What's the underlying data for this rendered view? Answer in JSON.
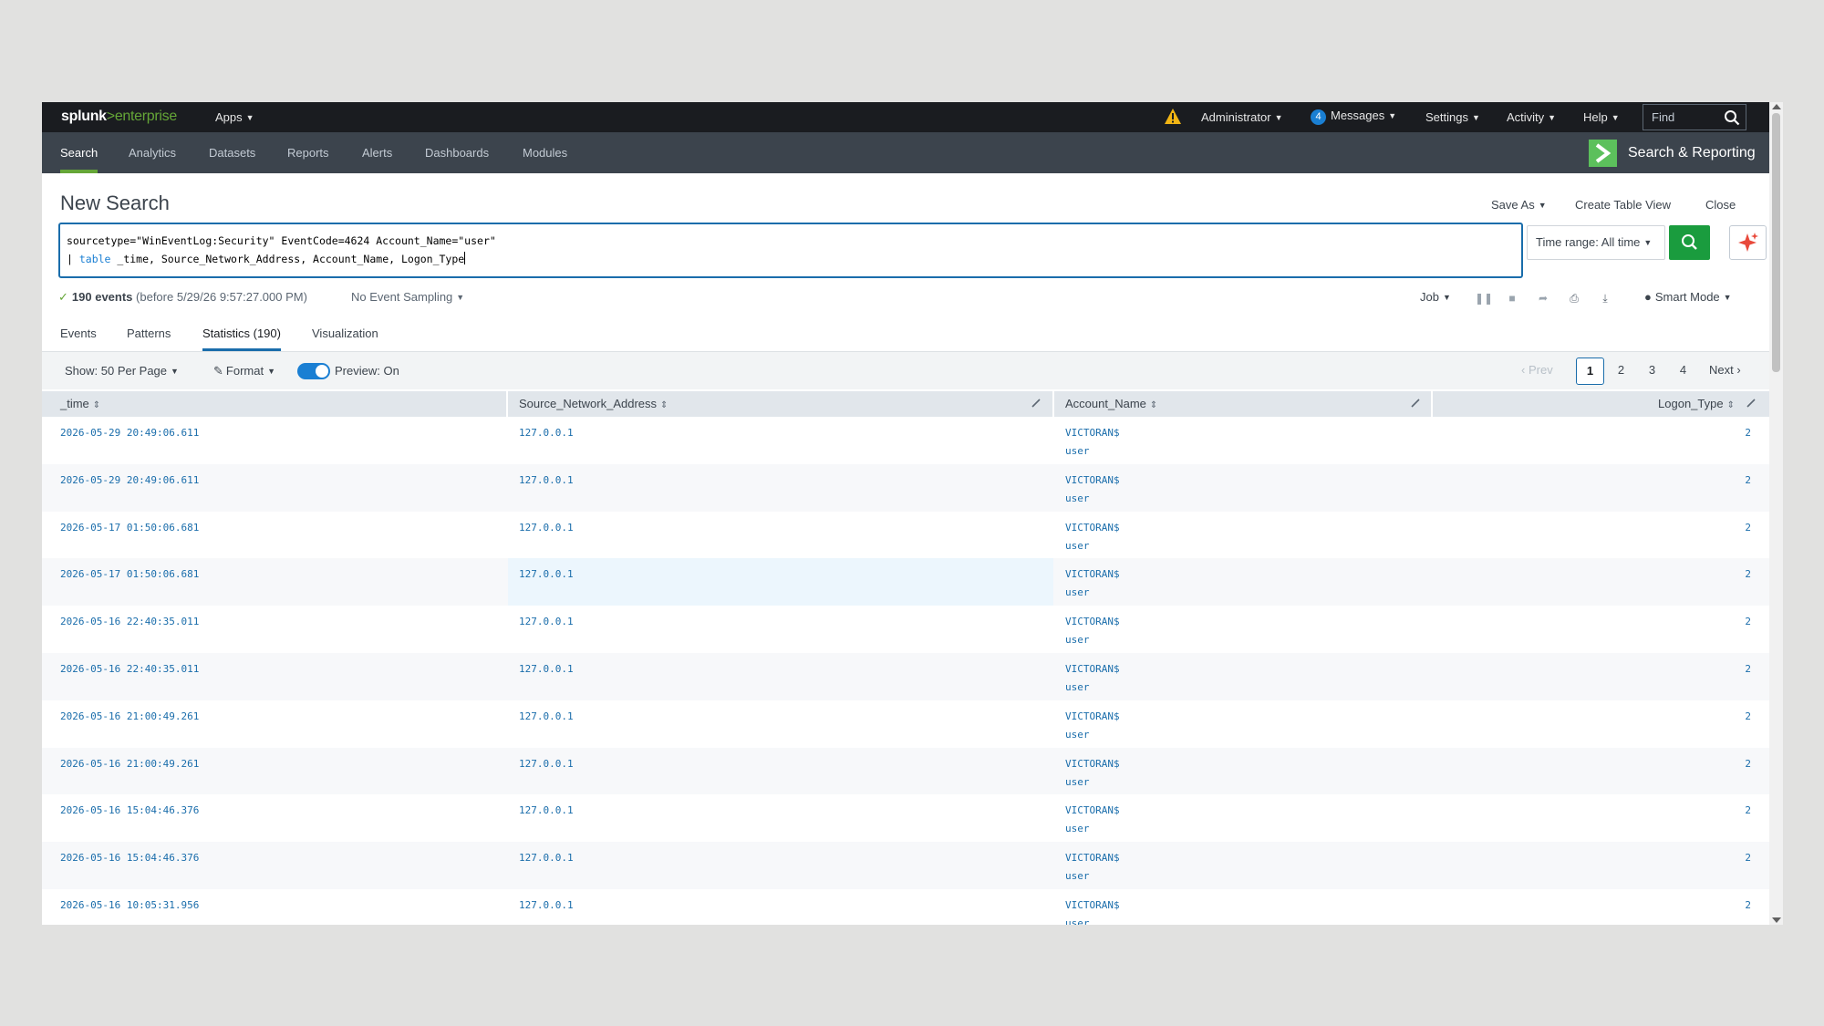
{
  "topbar": {
    "logo_splunk": "splunk",
    "logo_gt": ">",
    "logo_enterprise": "enterprise",
    "apps": "Apps",
    "administrator": "Administrator",
    "messages_count": "4",
    "messages": "Messages",
    "settings": "Settings",
    "activity": "Activity",
    "help": "Help",
    "find_placeholder": "Find"
  },
  "appbar": {
    "nav": [
      "Search",
      "Analytics",
      "Datasets",
      "Reports",
      "Alerts",
      "Dashboards",
      "Modules"
    ],
    "app_name": "Search & Reporting"
  },
  "page": {
    "title": "New Search",
    "save_as": "Save As",
    "create_table_view": "Create Table View",
    "close": "Close"
  },
  "search": {
    "line1": "sourcetype=\"WinEventLog:Security\" EventCode=4624 Account_Name=\"user\"",
    "line2_pipe": "| ",
    "line2_cmd": "table",
    "line2_rest": " _time, Source_Network_Address, Account_Name, Logon_Type",
    "time_range": "Time range: All time"
  },
  "status": {
    "count": "190 events",
    "before": "(before 5/29/26 9:57:27.000 PM)",
    "sampling": "No Event Sampling",
    "job": "Job",
    "mode": "Smart Mode"
  },
  "tabs": [
    "Events",
    "Patterns",
    "Statistics (190)",
    "Visualization"
  ],
  "toolbar": {
    "show": "Show: 50 Per Page",
    "format": "Format",
    "preview": "Preview: On",
    "prev": "Prev",
    "pages": [
      "1",
      "2",
      "3",
      "4"
    ],
    "next": "Next"
  },
  "table": {
    "columns": [
      "_time",
      "Source_Network_Address",
      "Account_Name",
      "Logon_Type"
    ],
    "rows": [
      {
        "time": "2026-05-29 20:49:06.611",
        "addr": "127.0.0.1",
        "name1": "VICTORAN$",
        "name2": "user",
        "type": "2"
      },
      {
        "time": "2026-05-29 20:49:06.611",
        "addr": "127.0.0.1",
        "name1": "VICTORAN$",
        "name2": "user",
        "type": "2"
      },
      {
        "time": "2026-05-17 01:50:06.681",
        "addr": "127.0.0.1",
        "name1": "VICTORAN$",
        "name2": "user",
        "type": "2"
      },
      {
        "time": "2026-05-17 01:50:06.681",
        "addr": "127.0.0.1",
        "name1": "VICTORAN$",
        "name2": "user",
        "type": "2"
      },
      {
        "time": "2026-05-16 22:40:35.011",
        "addr": "127.0.0.1",
        "name1": "VICTORAN$",
        "name2": "user",
        "type": "2"
      },
      {
        "time": "2026-05-16 22:40:35.011",
        "addr": "127.0.0.1",
        "name1": "VICTORAN$",
        "name2": "user",
        "type": "2"
      },
      {
        "time": "2026-05-16 21:00:49.261",
        "addr": "127.0.0.1",
        "name1": "VICTORAN$",
        "name2": "user",
        "type": "2"
      },
      {
        "time": "2026-05-16 21:00:49.261",
        "addr": "127.0.0.1",
        "name1": "VICTORAN$",
        "name2": "user",
        "type": "2"
      },
      {
        "time": "2026-05-16 15:04:46.376",
        "addr": "127.0.0.1",
        "name1": "VICTORAN$",
        "name2": "user",
        "type": "2"
      },
      {
        "time": "2026-05-16 15:04:46.376",
        "addr": "127.0.0.1",
        "name1": "VICTORAN$",
        "name2": "user",
        "type": "2"
      },
      {
        "time": "2026-05-16 10:05:31.956",
        "addr": "127.0.0.1",
        "name1": "VICTORAN$",
        "name2": "user",
        "type": "2"
      }
    ]
  },
  "colors": {
    "topbar": "#1a1c20",
    "appbar": "#3c444d",
    "accent_green": "#65a637",
    "search_button": "#1a9c3e",
    "link_blue": "#1a6dab",
    "hover_row": "#ecf6fd"
  }
}
